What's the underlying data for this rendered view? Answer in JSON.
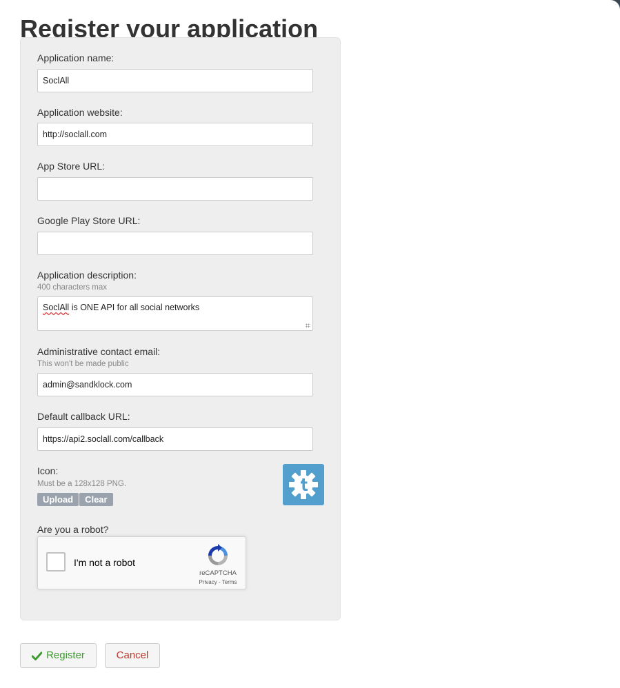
{
  "page": {
    "title": "Register your application"
  },
  "form": {
    "app_name": {
      "label": "Application name:",
      "value": "SoclAll"
    },
    "app_website": {
      "label": "Application website:",
      "value": "http://soclall.com"
    },
    "app_store_url": {
      "label": "App Store URL:",
      "value": ""
    },
    "play_store_url": {
      "label": "Google Play Store URL:",
      "value": ""
    },
    "description": {
      "label": "Application description:",
      "hint": "400 characters max",
      "value_misspelled": "SoclAll",
      "value_rest": " is ONE API for all social networks"
    },
    "admin_email": {
      "label": "Administrative contact email:",
      "hint": "This won't be made public",
      "value": "admin@sandklock.com"
    },
    "callback_url": {
      "label": "Default callback URL:",
      "value": "https://api2.soclall.com/callback"
    },
    "icon": {
      "label": "Icon:",
      "hint": "Must be a 128x128 PNG.",
      "upload_label": "Upload",
      "clear_label": "Clear",
      "preview_icon": "tumblr-gear-icon",
      "preview_color": "#529ecc"
    },
    "robot": {
      "label": "Are you a robot?",
      "checkbox_text": "I'm not a robot",
      "brand": "reCAPTCHA",
      "privacy": "Privacy",
      "separator": " - ",
      "terms": "Terms"
    }
  },
  "actions": {
    "register_label": "Register",
    "cancel_label": "Cancel"
  },
  "colors": {
    "register_text": "#3c9a2e",
    "cancel_text": "#c0392b",
    "panel_bg": "#eeeeee"
  }
}
